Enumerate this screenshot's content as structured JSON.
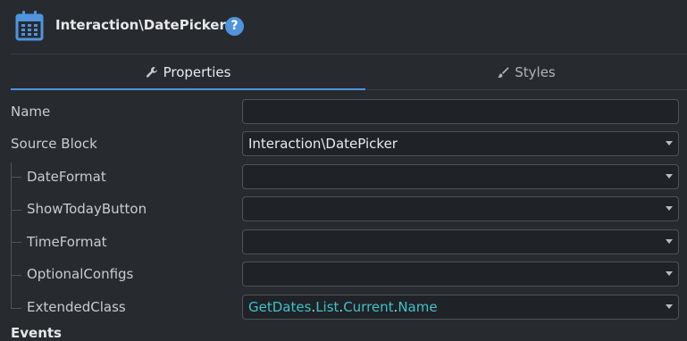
{
  "header": {
    "title": "Interaction\\DatePicker",
    "help_glyph": "?",
    "icon": "calendar-icon"
  },
  "tabs": [
    {
      "label": "Properties",
      "icon": "wrench-icon",
      "active": true
    },
    {
      "label": "Styles",
      "icon": "brush-icon",
      "active": false
    }
  ],
  "fields": {
    "name": {
      "label": "Name",
      "value": ""
    },
    "source_block": {
      "label": "Source Block",
      "value": "Interaction\\DatePicker"
    },
    "date_format": {
      "label": "DateFormat",
      "value": ""
    },
    "show_today_button": {
      "label": "ShowTodayButton",
      "value": ""
    },
    "time_format": {
      "label": "TimeFormat",
      "value": ""
    },
    "optional_configs": {
      "label": "OptionalConfigs",
      "value": ""
    },
    "extended_class": {
      "label": "ExtendedClass",
      "value_parts": [
        "GetDates",
        ".",
        "List",
        ".",
        "Current",
        ".",
        "Name"
      ]
    }
  },
  "section": {
    "events_label": "Events"
  },
  "colors": {
    "accent": "#4f94dc",
    "background": "#272b30",
    "field_bg": "#1f2327",
    "expression": "#3fc1c9"
  }
}
